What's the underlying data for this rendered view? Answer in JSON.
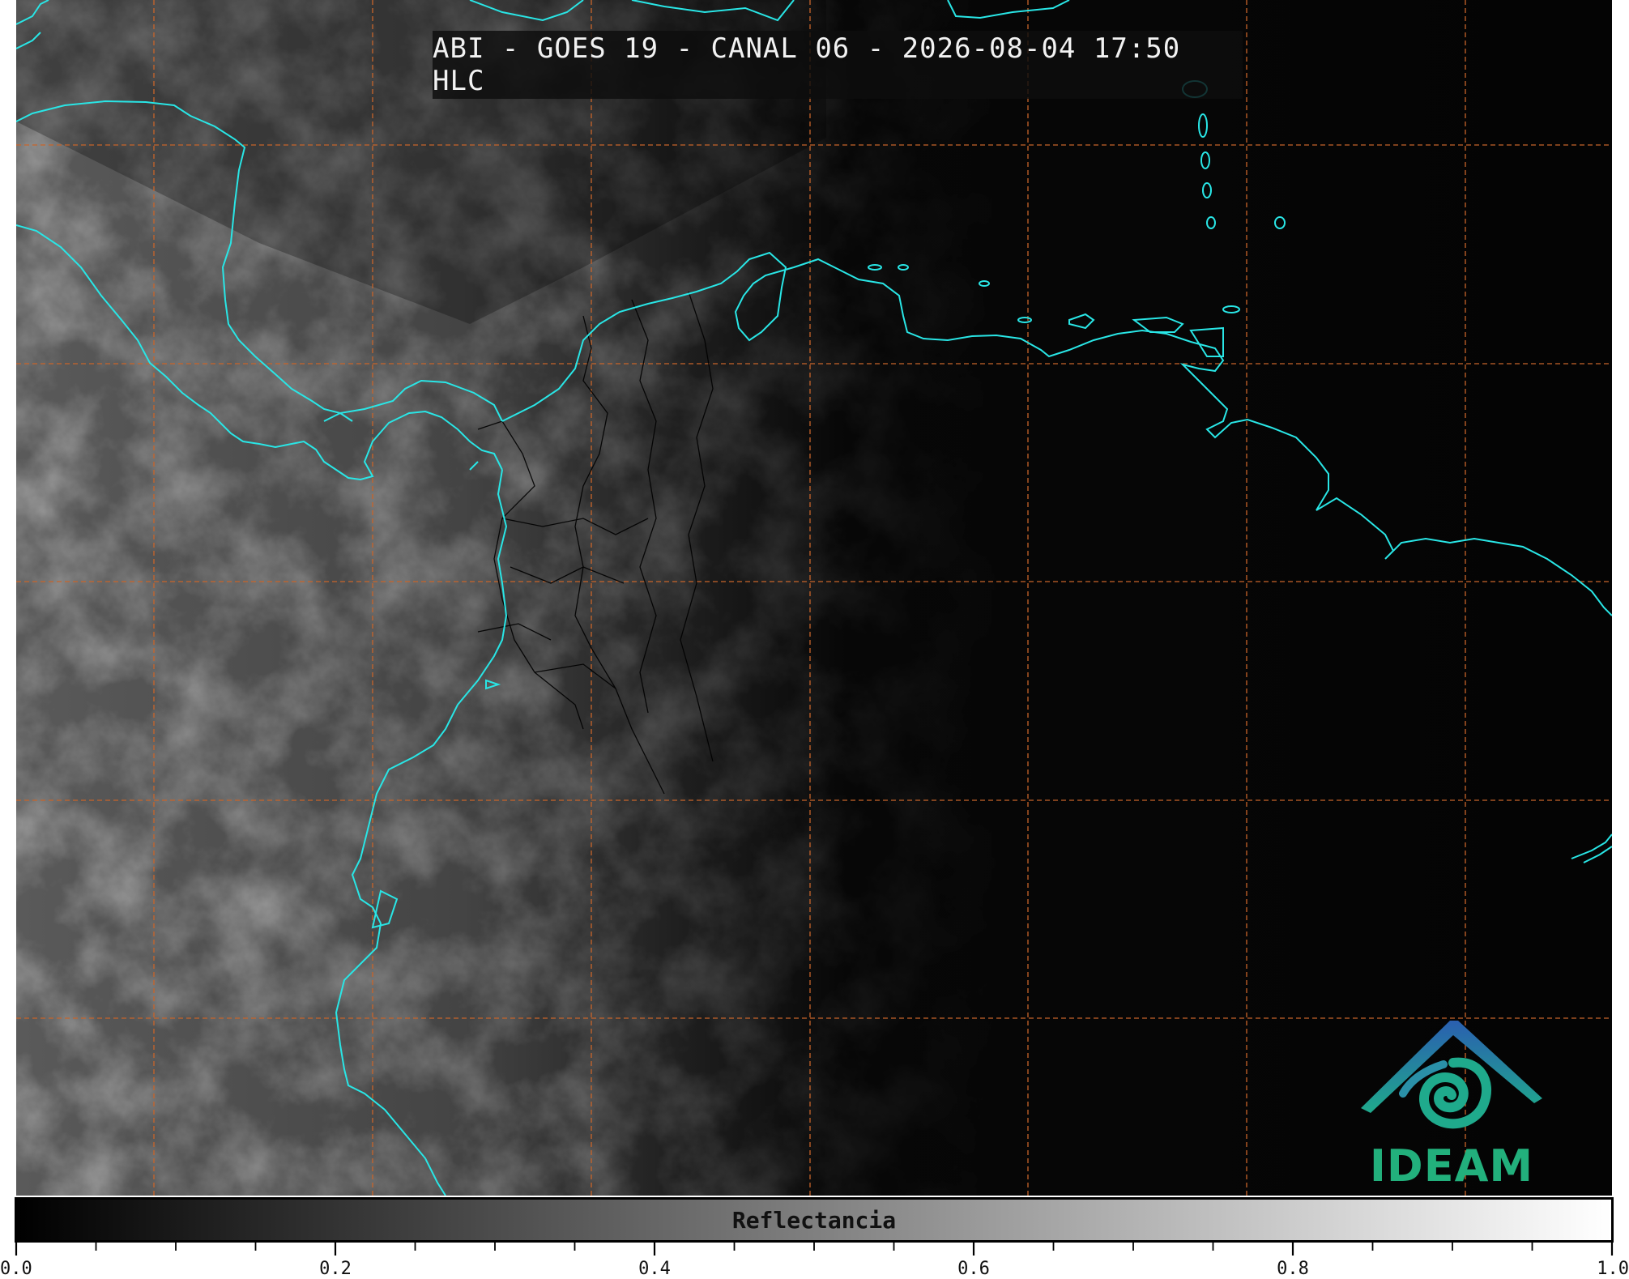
{
  "title": "ABI - GOES 19 - CANAL 06 - 2026-08-04 17:50 HLC",
  "colorbar": {
    "label": "Reflectancia",
    "min": 0.0,
    "max": 1.0,
    "cmap": "grayscale (black to white)",
    "major_ticks": [
      "0.0",
      "0.2",
      "0.4",
      "0.6",
      "0.8",
      "1.0"
    ],
    "minor_tick_step": 0.05
  },
  "logo": {
    "text": "IDEAM"
  },
  "colors": {
    "coastline": "#29e6e6",
    "borders": "#000000",
    "gridlines": "#c8642a",
    "background": "#040404",
    "title_text": "#f2f2f2",
    "logo_text": "#22b07c"
  },
  "map": {
    "gridlines": "dashed",
    "grid_rows": 6,
    "grid_cols": 8
  }
}
